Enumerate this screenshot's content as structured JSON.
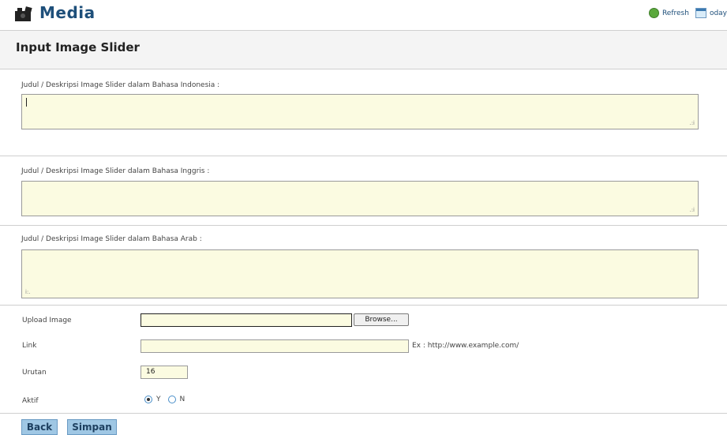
{
  "header": {
    "title": "Media",
    "refresh_label": "Refresh",
    "date_label": "oday"
  },
  "form": {
    "title": "Input Image Slider",
    "desc_id_label": "Judul / Deskripsi Image Slider dalam Bahasa Indonesia :",
    "desc_id_value": "",
    "desc_en_label": "Judul / Deskripsi Image Slider dalam Bahasa Inggris :",
    "desc_en_value": "",
    "desc_ar_label": "Judul / Deskripsi Image Slider dalam Bahasa Arab :",
    "desc_ar_value": "",
    "upload_label": "Upload Image",
    "upload_value": "",
    "browse_label": "Browse...",
    "link_label": "Link",
    "link_value": "",
    "link_hint": "Ex : http://www.example.com/",
    "order_label": "Urutan",
    "order_value": "16",
    "active_label": "Aktif",
    "active_yes": "Y",
    "active_no": "N",
    "active_selected": "Y"
  },
  "buttons": {
    "back": "Back",
    "save": "Simpan"
  }
}
